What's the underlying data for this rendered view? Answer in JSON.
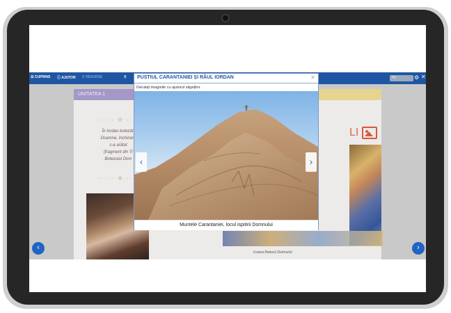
{
  "toolbar": {
    "items": [
      "CUPRINS",
      "AJUTOR",
      "RESURSE",
      ""
    ],
    "search_placeholder": "Pe"
  },
  "page": {
    "unit_label": "UNITATEA 1",
    "ornament": "-·:·- ✣ -·:·-",
    "poem_lines": [
      "În Iordan botezân",
      "Doamne, închinare",
      "s-a arătat",
      "(fragment din Tr",
      "Botezului Dom"
    ],
    "right_heading": "LI",
    "right_caption": "Icoana Botezul Domnului"
  },
  "modal": {
    "title": "PUSTIUL CARANTANIEI ȘI RÂUL IORDAN",
    "instruction": "Derulați imaginile cu ajutorul săgeților.",
    "caption": "Muntele Carantaniei, locul ispitirii Domnului"
  },
  "colors": {
    "toolbar": "#1f56a3",
    "accent_purple": "#a597c7",
    "accent_gold": "#e6d48f",
    "nav_blue": "#1f64c2"
  },
  "icons": {
    "prev_page": "chevron-left-circle-icon",
    "next_page": "chevron-right-circle-icon",
    "photo_prev": "chevron-left-icon",
    "photo_next": "chevron-right-icon",
    "close": "close-icon",
    "settings": "gear-icon",
    "image": "image-icon"
  }
}
